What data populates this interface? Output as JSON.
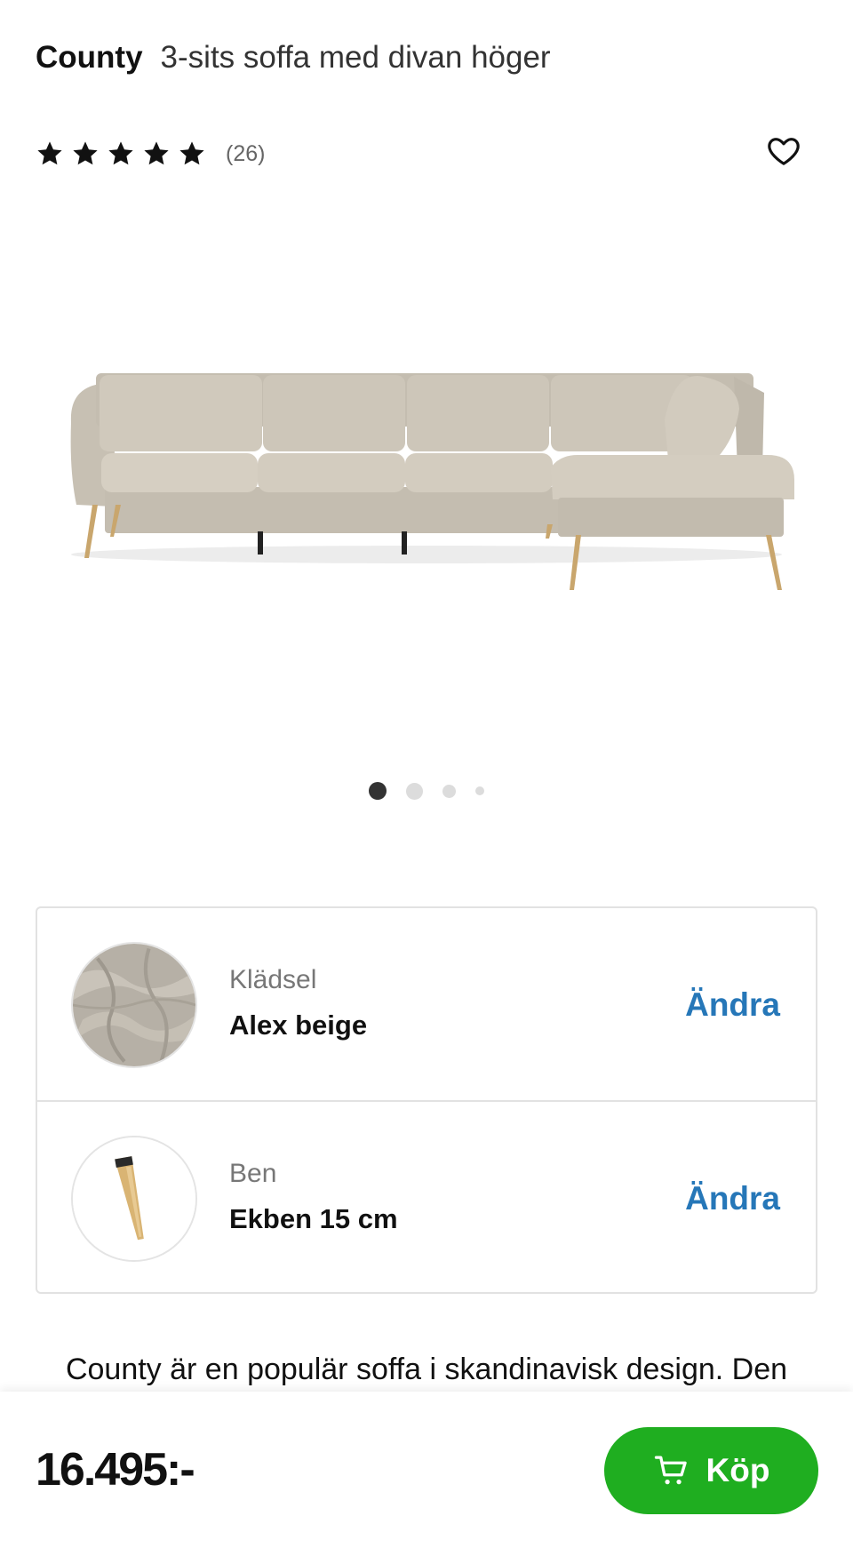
{
  "product": {
    "brand": "County",
    "name": "3-sits soffa med divan höger",
    "review_count": "(26)",
    "rating": 5
  },
  "gallery": {
    "image_count": 4,
    "active_index": 0
  },
  "configuration": [
    {
      "label": "Klädsel",
      "value": "Alex beige",
      "action": "Ändra",
      "icon": "fabric-swatch-icon"
    },
    {
      "label": "Ben",
      "value": "Ekben 15 cm",
      "action": "Ändra",
      "icon": "wooden-leg-icon"
    }
  ],
  "description": "County är en populär soffa i skandinavisk design. Den",
  "footer": {
    "price": "16.495:-",
    "buy_label": "Köp"
  },
  "colors": {
    "buy_green": "#1fae20",
    "link_blue": "#2677b8",
    "upholstery_beige": "#cbc4b7"
  }
}
